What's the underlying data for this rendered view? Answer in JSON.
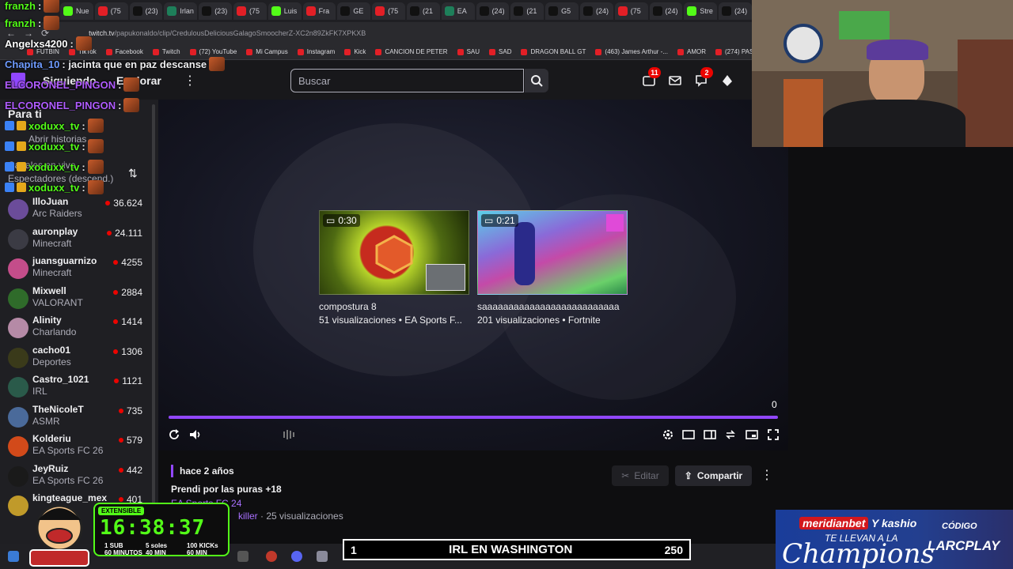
{
  "browser": {
    "tabs": [
      {
        "label": "Nue",
        "fav_color": "#53fc18"
      },
      {
        "label": "(75",
        "fav_color": "#e21f26"
      },
      {
        "label": "(23)",
        "fav_color": "#111111"
      },
      {
        "label": "Irlan",
        "fav_color": "#1e7f5a"
      },
      {
        "label": "(23)",
        "fav_color": "#111111"
      },
      {
        "label": "(75",
        "fav_color": "#e21f26"
      },
      {
        "label": "Luis",
        "fav_color": "#53fc18"
      },
      {
        "label": "Fra",
        "fav_color": "#e21f26"
      },
      {
        "label": "GE",
        "fav_color": "#111111"
      },
      {
        "label": "(75",
        "fav_color": "#e21f26"
      },
      {
        "label": "(21",
        "fav_color": "#111111"
      },
      {
        "label": "EA",
        "fav_color": "#1e7f5a"
      },
      {
        "label": "(24)",
        "fav_color": "#111111"
      },
      {
        "label": "(21",
        "fav_color": "#111111"
      },
      {
        "label": "G5",
        "fav_color": "#111111"
      },
      {
        "label": "(24)",
        "fav_color": "#111111"
      },
      {
        "label": "(75",
        "fav_color": "#e21f26"
      },
      {
        "label": "(24)",
        "fav_color": "#111111"
      },
      {
        "label": "Stre",
        "fav_color": "#53fc18"
      },
      {
        "label": "(24)",
        "fav_color": "#111111"
      }
    ],
    "url_host": "twitch.tv",
    "url_path": "/papukonaldo/clip/CredulousDeliciousGalagoSmoocherZ-XC2n89ZkFK7XPKXB",
    "bookmarks": [
      "FUTBIN",
      "TikTok",
      "Facebook",
      "Twitch",
      "(72) YouTube",
      "Mi Campus",
      "Instagram",
      "Kick",
      "CANCION DE PETER",
      "SAU",
      "SAD",
      "DRAGON BALL GT",
      "(463) James Arthur -...",
      "AMOR",
      "(274) PAS"
    ]
  },
  "topnav": {
    "following": "Siguiendo",
    "explore": "Explorar",
    "search_placeholder": "Buscar",
    "notif_count": "11",
    "whispers_count": "2"
  },
  "sidebar": {
    "title": "Para ti",
    "stories_label": "Abrir historias",
    "section_label": "Canales en vivo",
    "sort_label": "Espectadores (descend.)",
    "channels": [
      {
        "name": "IlloJuan",
        "game": "Arc Raiders",
        "viewers": "36.624",
        "color": "#6b4c9a"
      },
      {
        "name": "auronplay",
        "game": "Minecraft",
        "viewers": "24.111",
        "color": "#3b3b44"
      },
      {
        "name": "juansguarnizo",
        "game": "Minecraft",
        "viewers": "4255",
        "color": "#c44d8a"
      },
      {
        "name": "Mixwell",
        "game": "VALORANT",
        "viewers": "2884",
        "color": "#2f6b2a"
      },
      {
        "name": "Alinity",
        "game": "Charlando",
        "viewers": "1414",
        "color": "#b58aa6"
      },
      {
        "name": "cacho01",
        "game": "Deportes",
        "viewers": "1306",
        "color": "#3a3a1a"
      },
      {
        "name": "Castro_1021",
        "game": "IRL",
        "viewers": "1121",
        "color": "#2a5a4a"
      },
      {
        "name": "TheNicoleT",
        "game": "ASMR",
        "viewers": "735",
        "color": "#4a6a9a"
      },
      {
        "name": "Kolderiu",
        "game": "EA Sports FC 26",
        "viewers": "579",
        "color": "#d24a1a"
      },
      {
        "name": "JeyRuiz",
        "game": "EA Sports FC 26",
        "viewers": "442",
        "color": "#1a1a1a"
      },
      {
        "name": "kingteague_mex",
        "game": "",
        "viewers": "401",
        "color": "#c09a2a"
      }
    ]
  },
  "player": {
    "recommendations": [
      {
        "duration": "0:30",
        "title": "compostura 8",
        "meta": "51 visualizaciones • EA Sports F..."
      },
      {
        "duration": "0:21",
        "title": "saaaaaaaaaaaaaaaaaaaaaaaaaa",
        "meta": "201 visualizaciones • Fortnite"
      }
    ],
    "time": "0"
  },
  "clip": {
    "age": "hace 2 años",
    "title": "Prendi por las puras +18",
    "game": "EA Sports FC 24",
    "clipper": "killer",
    "views": "· 25 visualizaciones",
    "edit_label": "Editar",
    "share_label": "Compartir"
  },
  "chat": [
    {
      "user": "franzh",
      "text": ":",
      "color": "#53fc18"
    },
    {
      "user": "franzh",
      "text": ":",
      "color": "#53fc18"
    },
    {
      "user": "Angelxs4200",
      "text": ":",
      "color": "#ffffff"
    },
    {
      "user": "Chapita_10",
      "text": ": jacinta que en paz descanse",
      "color": "#6e9bff"
    },
    {
      "user": "ELCORONEL_PINGON",
      "text": ":",
      "color": "#b05cff"
    },
    {
      "user": "ELCORONEL_PINGON",
      "text": ":",
      "color": "#b05cff"
    },
    {
      "user": "xoduxx_tv",
      "text": ":",
      "color": "#53fc18"
    },
    {
      "user": "xoduxx_tv",
      "text": ":",
      "color": "#53fc18"
    },
    {
      "user": "xoduxx_tv",
      "text": ":",
      "color": "#53fc18"
    },
    {
      "user": "xoduxx_tv",
      "text": ":",
      "color": "#53fc18"
    }
  ],
  "overlay": {
    "timer_tag": "EXTENSIBLE",
    "timer": "16:38:37",
    "rules": [
      {
        "a": "1 SUB",
        "b": "60 MINUTOS"
      },
      {
        "a": "5 soles",
        "b": "40 MIN"
      },
      {
        "a": "100 KICKs",
        "b": "60 MIN"
      }
    ],
    "goal_left": "1",
    "goal_title": "IRL EN WASHINGTON",
    "goal_right": "250",
    "promo_brand": "meridianbet",
    "promo_and": "Y kashio",
    "promo_tag": "TE LLEVAN A LA",
    "promo_champ": "Champions",
    "promo_code_label": "CÓDIGO",
    "promo_code": "LARCPLAY"
  }
}
